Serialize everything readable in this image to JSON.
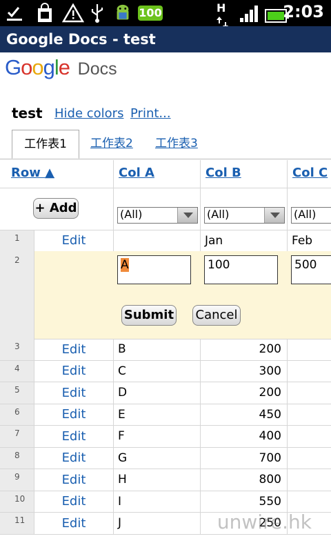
{
  "status_bar": {
    "battery_badge": "100",
    "network": "H",
    "clock": "2:03"
  },
  "app": {
    "title": "Google Docs - test"
  },
  "header": {
    "logo_google": [
      "G",
      "o",
      "o",
      "g",
      "l",
      "e"
    ],
    "logo_docs": "Docs",
    "doc_title": "test",
    "hide_colors": "Hide colors",
    "print": "Print..."
  },
  "tabs": [
    "工作表1",
    "工作表2",
    "工作表3"
  ],
  "table": {
    "columns": [
      "Row ▲",
      "Col A",
      "Col B",
      "Col C"
    ],
    "add_button": "+ Add",
    "filter_value": "(All)",
    "row1": {
      "num": "1",
      "edit": "Edit",
      "col_b": "Jan",
      "col_c": "Feb"
    },
    "edit_row": {
      "num": "2",
      "col_a": "A",
      "col_b": "100",
      "col_c": "500",
      "submit": "Submit",
      "cancel": "Cancel"
    },
    "rows": [
      {
        "num": "3",
        "edit": "Edit",
        "col_a": "B",
        "col_b": "200"
      },
      {
        "num": "4",
        "edit": "Edit",
        "col_a": "C",
        "col_b": "300"
      },
      {
        "num": "5",
        "edit": "Edit",
        "col_a": "D",
        "col_b": "200"
      },
      {
        "num": "6",
        "edit": "Edit",
        "col_a": "E",
        "col_b": "450"
      },
      {
        "num": "7",
        "edit": "Edit",
        "col_a": "F",
        "col_b": "400"
      },
      {
        "num": "8",
        "edit": "Edit",
        "col_a": "G",
        "col_b": "700"
      },
      {
        "num": "9",
        "edit": "Edit",
        "col_a": "H",
        "col_b": "800"
      },
      {
        "num": "10",
        "edit": "Edit",
        "col_a": "I",
        "col_b": "550"
      },
      {
        "num": "11",
        "edit": "Edit",
        "col_a": "J",
        "col_b": "250"
      }
    ]
  },
  "watermark": "unwire.hk"
}
